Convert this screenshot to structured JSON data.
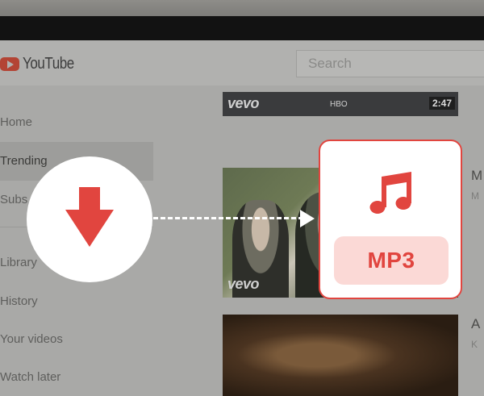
{
  "header": {
    "logo_text": "YouTube",
    "search_placeholder": "Search"
  },
  "sidebar": {
    "items": [
      {
        "label": "Home"
      },
      {
        "label": "Trending"
      },
      {
        "label": "Subs"
      },
      {
        "label": "Library"
      },
      {
        "label": "History"
      },
      {
        "label": "Your videos"
      },
      {
        "label": "Watch later"
      }
    ]
  },
  "videos": [
    {
      "brand": "vevo",
      "hbo_tag": "HBO",
      "duration": "2:47"
    },
    {
      "brand": "vevo",
      "title_fragment": "M",
      "sub_fragment": "M"
    },
    {
      "title_fragment": "A",
      "sub_fragment": "K"
    }
  ],
  "overlay": {
    "format_label": "MP3",
    "icons": [
      "download-arrow-icon",
      "music-note-icon"
    ],
    "accent_color": "#e1453f",
    "pill_color": "#fbd9d6"
  }
}
